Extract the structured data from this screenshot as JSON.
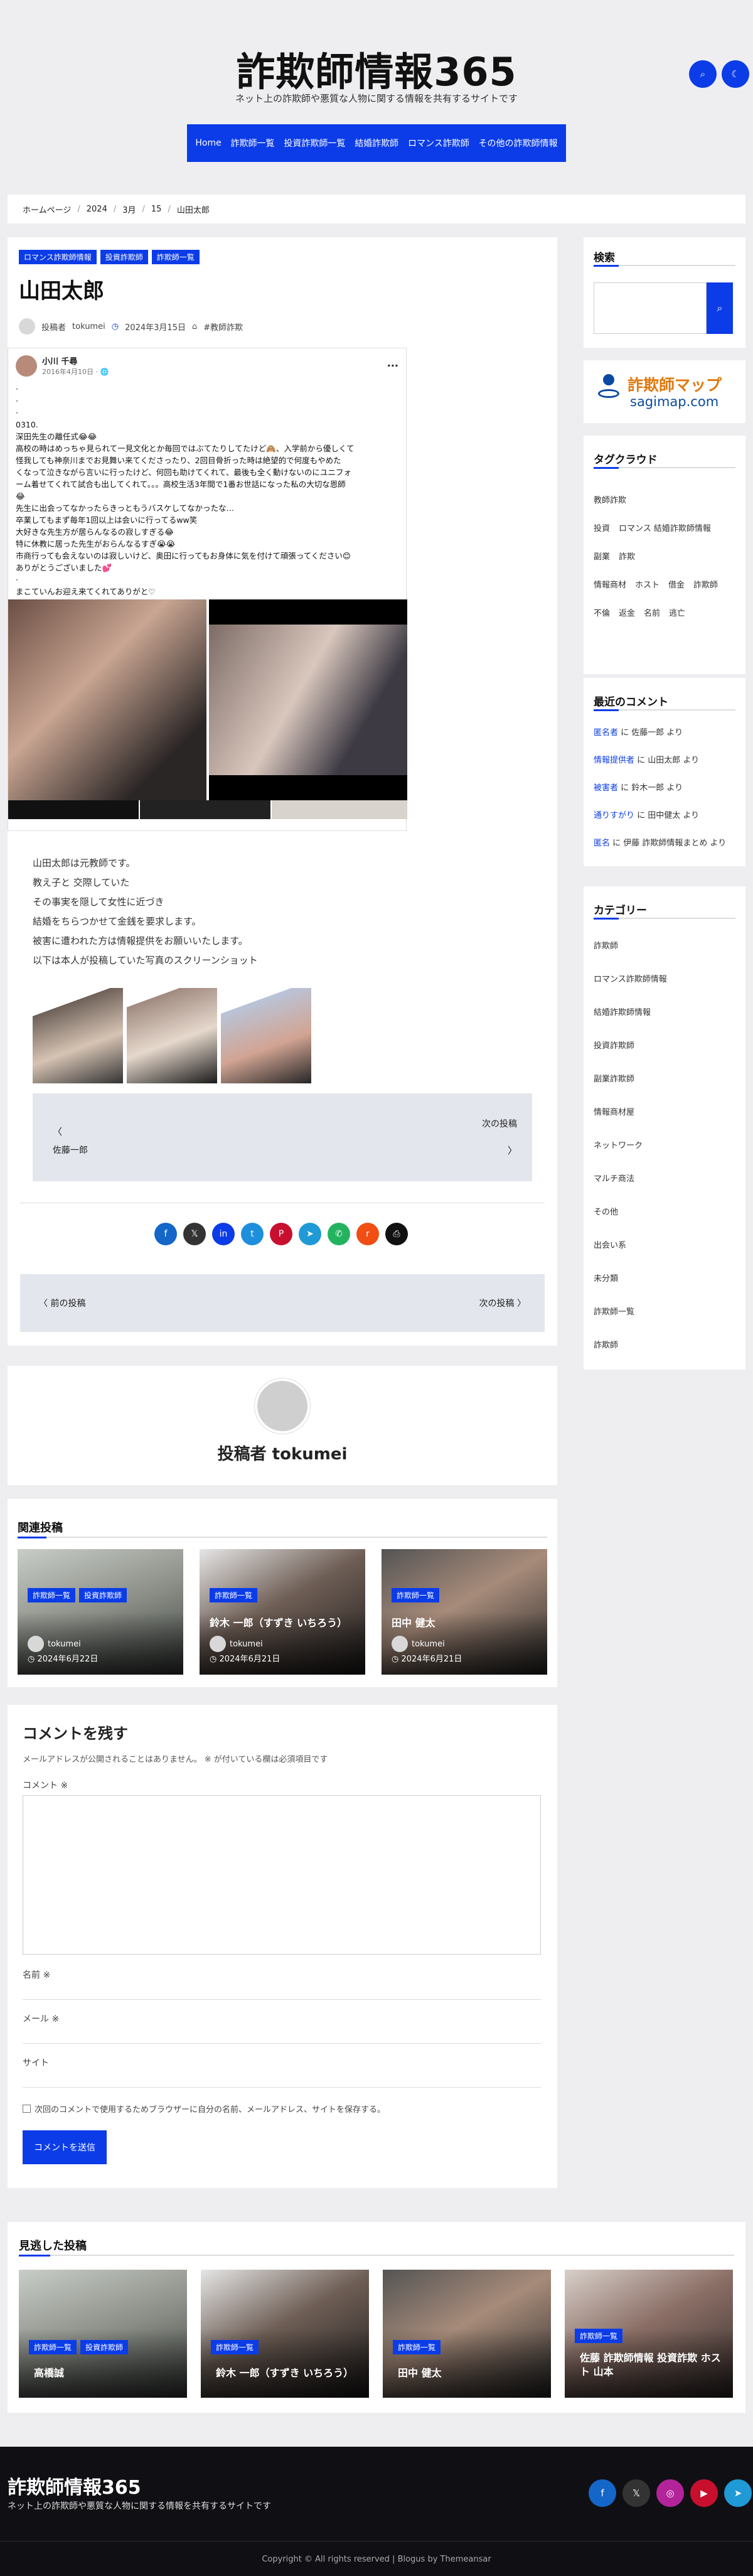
{
  "site": {
    "title": "詐欺師情報365",
    "tagline": "ネット上の詐欺師や悪質な人物に関する情報を共有するサイトです",
    "search_button_icon": "search-icon",
    "dark_mode_icon": "moon-icon"
  },
  "nav": {
    "items": [
      "Home",
      "詐欺師一覧",
      "投資詐欺師一覧",
      "結婚詐欺師",
      "ロマンス詐欺師",
      "その他の詐欺師情報"
    ]
  },
  "breadcrumb": [
    "ホームページ",
    "2024",
    "3月",
    "15",
    "山田太郎"
  ],
  "post": {
    "categories": [
      "ロマンス詐欺師情報",
      "投資詐欺師",
      "詐欺師一覧"
    ],
    "title": "山田太郎",
    "author_prefix": "投稿者",
    "author": "tokumei",
    "date": "2024年3月15日",
    "tag": "#教師詐欺",
    "fb": {
      "name": "小川 千尋",
      "date": "2016年4月10日 · 🌐",
      "menu": "···",
      "lines": [
        "·",
        "·",
        "·",
        "0310.",
        "深田先生の離任式😂😂",
        "高校の時はめっちゃ見られて一見文化とか毎回ではぶてたりしてたけど🙈、入学前から優しくて",
        "怪我しても神奈川までお見舞い来てくださったり、2回目骨折った時は絶望的で何度もやめた",
        "くなって泣きながら言いに行ったけど、何回も助けてくれて、最後も全く動けないのにユニフォ",
        "ーム着せてくれて試合も出してくれて。。。高校生活3年間で1番お世話になった私の大切な恩師",
        "😂",
        "先生に出会ってなかったらきっともうバスケしてなかったな…",
        "卒業してもまず毎年1回以上は会いに行ってるww笑",
        "大好きな先生方が居らんなるの寂しすぎる😂",
        "特に休教に居った先生がおらんなるすぎ😭😭",
        "市商行っても会えないのは寂しいけど、奥田に行ってもお身体に気を付けて頑張ってください😊",
        "ありがとうございました💕",
        "·",
        "まこていんお迎え来てくれてありがと♡"
      ]
    },
    "body_lines": [
      "山田太郎は元教師です。",
      "教え子と 交際していた",
      "その事実を隠して女性に近づき",
      "結婚をちらつかせて金銭を要求します。",
      "被害に遭われた方は情報提供をお願いいたします。",
      "",
      "以下は本人が投稿していた写真のスクリーンショット"
    ],
    "prev_label": "前の投稿",
    "prev_title": "佐藤一郎",
    "next_label": "次の投稿",
    "next_title": "〉",
    "prev_arrow": "〈",
    "nav_prev": "〈 前の投稿",
    "nav_next": "次の投稿 〉"
  },
  "share_icons": [
    {
      "name": "facebook-icon",
      "glyph": "f",
      "color": "#1466c8"
    },
    {
      "name": "x-icon",
      "glyph": "𝕏",
      "color": "#333"
    },
    {
      "name": "linkedin-icon",
      "glyph": "in",
      "color": "#0b3ce8"
    },
    {
      "name": "twitter-icon",
      "glyph": "t",
      "color": "#1d8fdc"
    },
    {
      "name": "pinterest-icon",
      "glyph": "P",
      "color": "#c8102e"
    },
    {
      "name": "telegram-icon",
      "glyph": "➤",
      "color": "#1f9ad6"
    },
    {
      "name": "whatsapp-icon",
      "glyph": "✆",
      "color": "#23b35f"
    },
    {
      "name": "reddit-icon",
      "glyph": "r",
      "color": "#f04e12"
    },
    {
      "name": "print-icon",
      "glyph": "⎙",
      "color": "#111"
    }
  ],
  "author_box": {
    "prefix": "投稿者",
    "name": "tokumei"
  },
  "related": {
    "title": "関連投稿",
    "items": [
      {
        "badges": [
          "詐欺師一覧",
          "投資詐欺師"
        ],
        "title": "",
        "author": "tokumei",
        "date": "2024年6月22日"
      },
      {
        "badges": [
          "詐欺師一覧"
        ],
        "title": "鈴木 一郎（すずき いちろう）",
        "author": "tokumei",
        "date": "2024年6月21日"
      },
      {
        "badges": [
          "詐欺師一覧"
        ],
        "title": "田中 健太",
        "author": "tokumei",
        "date": "2024年6月21日"
      }
    ]
  },
  "comment": {
    "title": "コメントを残す",
    "note": "メールアドレスが公開されることはありません。 ※ が付いている欄は必須項目です",
    "comment_label": "コメント ※",
    "name_label": "名前 ※",
    "email_label": "メール ※",
    "site_label": "サイト",
    "checkbox_label": "次回のコメントで使用するためブラウザーに自分の名前、メールアドレス、サイトを保存する。",
    "submit": "コメントを送信"
  },
  "sidebar": {
    "search_title": "検索",
    "banner_main": "詐欺師マップ",
    "banner_sub": "sagimap.com",
    "tags_title": "タグクラウド",
    "tags": [
      "教師詐欺",
      "投資",
      "ロマンス 結婚詐欺師情報",
      "副業",
      "詐欺",
      "情報商材",
      "ホスト",
      "借金",
      "詐欺師",
      "不倫",
      "返金",
      "名前",
      "逃亡"
    ],
    "recent_title": "最近のコメント",
    "recent": [
      {
        "who": "匿名者",
        "on": "佐藤一郎"
      },
      {
        "who": "情報提供者",
        "on": "山田太郎"
      },
      {
        "who": "被害者",
        "on": "鈴木一郎"
      },
      {
        "who": "通りすがり",
        "on": "田中健太"
      },
      {
        "who": "匿名",
        "on": "伊藤 詐欺師情報まとめ"
      }
    ],
    "cat_title": "カテゴリー",
    "categories": [
      "詐欺師",
      "ロマンス詐欺師情報",
      "結婚詐欺師情報",
      "投資詐欺師",
      "副業詐欺師",
      "情報商材屋",
      "ネットワーク",
      "マルチ商法",
      "その他",
      "出会い系",
      "未分類",
      "詐欺師一覧",
      "詐欺師"
    ]
  },
  "popular": {
    "title": "見逃した投稿",
    "items": [
      {
        "badges": [
          "詐欺師一覧",
          "投資詐欺師"
        ],
        "title": "高橋誠"
      },
      {
        "badges": [
          "詐欺師一覧"
        ],
        "title": "鈴木 一郎（すずき いちろう）"
      },
      {
        "badges": [
          "詐欺師一覧"
        ],
        "title": "田中 健太"
      },
      {
        "badges": [
          "詐欺師一覧"
        ],
        "title": "佐藤 詐欺師情報 投資詐欺 ホスト 山本"
      }
    ]
  },
  "footer": {
    "title": "詐欺師情報365",
    "tagline": "ネット上の詐欺師や悪質な人物に関する情報を共有するサイトです",
    "copyright": "Copyright © All rights reserved | Blogus by Themeansar",
    "social": [
      {
        "name": "facebook-icon",
        "glyph": "f",
        "color": "#1466c8"
      },
      {
        "name": "x-icon",
        "glyph": "𝕏",
        "color": "#333"
      },
      {
        "name": "instagram-icon",
        "glyph": "◎",
        "color": "#b3249b"
      },
      {
        "name": "youtube-icon",
        "glyph": "▶",
        "color": "#c8102e"
      },
      {
        "name": "telegram-icon",
        "glyph": "➤",
        "color": "#1f9ad6"
      }
    ]
  },
  "colors": {
    "accent": "#0b3ce8",
    "footer_bg": "#101014"
  }
}
